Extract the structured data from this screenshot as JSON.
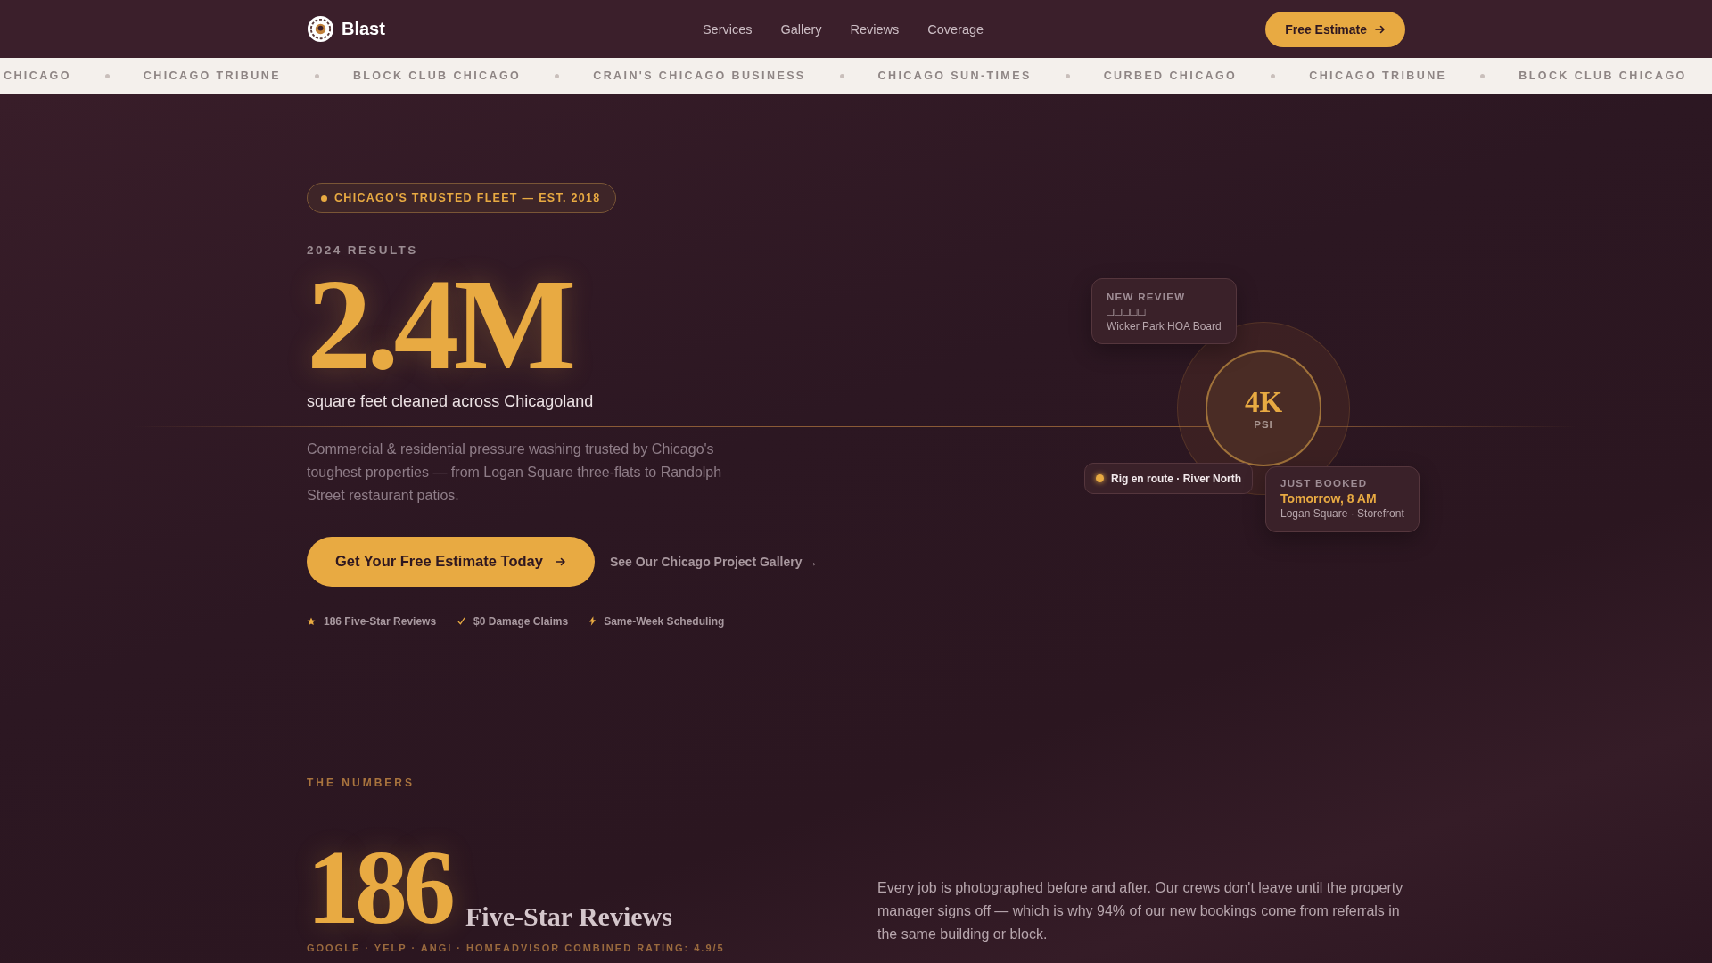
{
  "header": {
    "brand": "Blast",
    "nav": [
      {
        "label": "Services"
      },
      {
        "label": "Gallery"
      },
      {
        "label": "Reviews"
      },
      {
        "label": "Coverage"
      }
    ],
    "cta": "Free Estimate"
  },
  "ticker": [
    "CHICAGO",
    "CHICAGO TRIBUNE",
    "BLOCK CLUB CHICAGO",
    "CRAIN'S CHICAGO BUSINESS",
    "CHICAGO SUN-TIMES",
    "CURBED CHICAGO",
    "CHICAGO TRIBUNE",
    "BLOCK CLUB CHICAGO"
  ],
  "hero": {
    "badge": "CHICAGO'S TRUSTED FLEET — EST. 2018",
    "eyebrow": "2024 RESULTS",
    "stat": "2.4M",
    "stat_caption": "square feet cleaned across Chicagoland",
    "body": "Commercial & residential pressure washing trusted by Chicago's toughest properties — from Logan Square three-flats to Randolph Street restaurant patios.",
    "primary_button": "Get Your Free Estimate Today",
    "secondary_link": "See Our Chicago Project Gallery →",
    "proof": [
      {
        "kind": "star",
        "label": "186 Five-Star Reviews"
      },
      {
        "kind": "check",
        "label": "$0 Damage Claims"
      },
      {
        "kind": "bolt",
        "label": "Same-Week Scheduling"
      }
    ]
  },
  "gauge": {
    "value": "4K",
    "unit": "PSI",
    "review_card": {
      "title": "NEW REVIEW",
      "stars_text": "□□□□□",
      "author": "Wicker Park HOA Board"
    },
    "status_pill": "Rig en route · River North",
    "booking_card": {
      "title": "JUST BOOKED",
      "time": "Tomorrow, 8 AM",
      "place": "Logan Square · Storefront"
    }
  },
  "numbers": {
    "eyebrow": "THE NUMBERS",
    "stat": "186",
    "stat_label": "Five-Star Reviews",
    "source": "GOOGLE · YELP · ANGI · HOMEADVISOR COMBINED RATING: 4.9/5",
    "body": "Every job is photographed before and after. Our crews don't leave until the property manager signs off — which is why 94% of our new bookings come from referrals in the same building or block."
  }
}
